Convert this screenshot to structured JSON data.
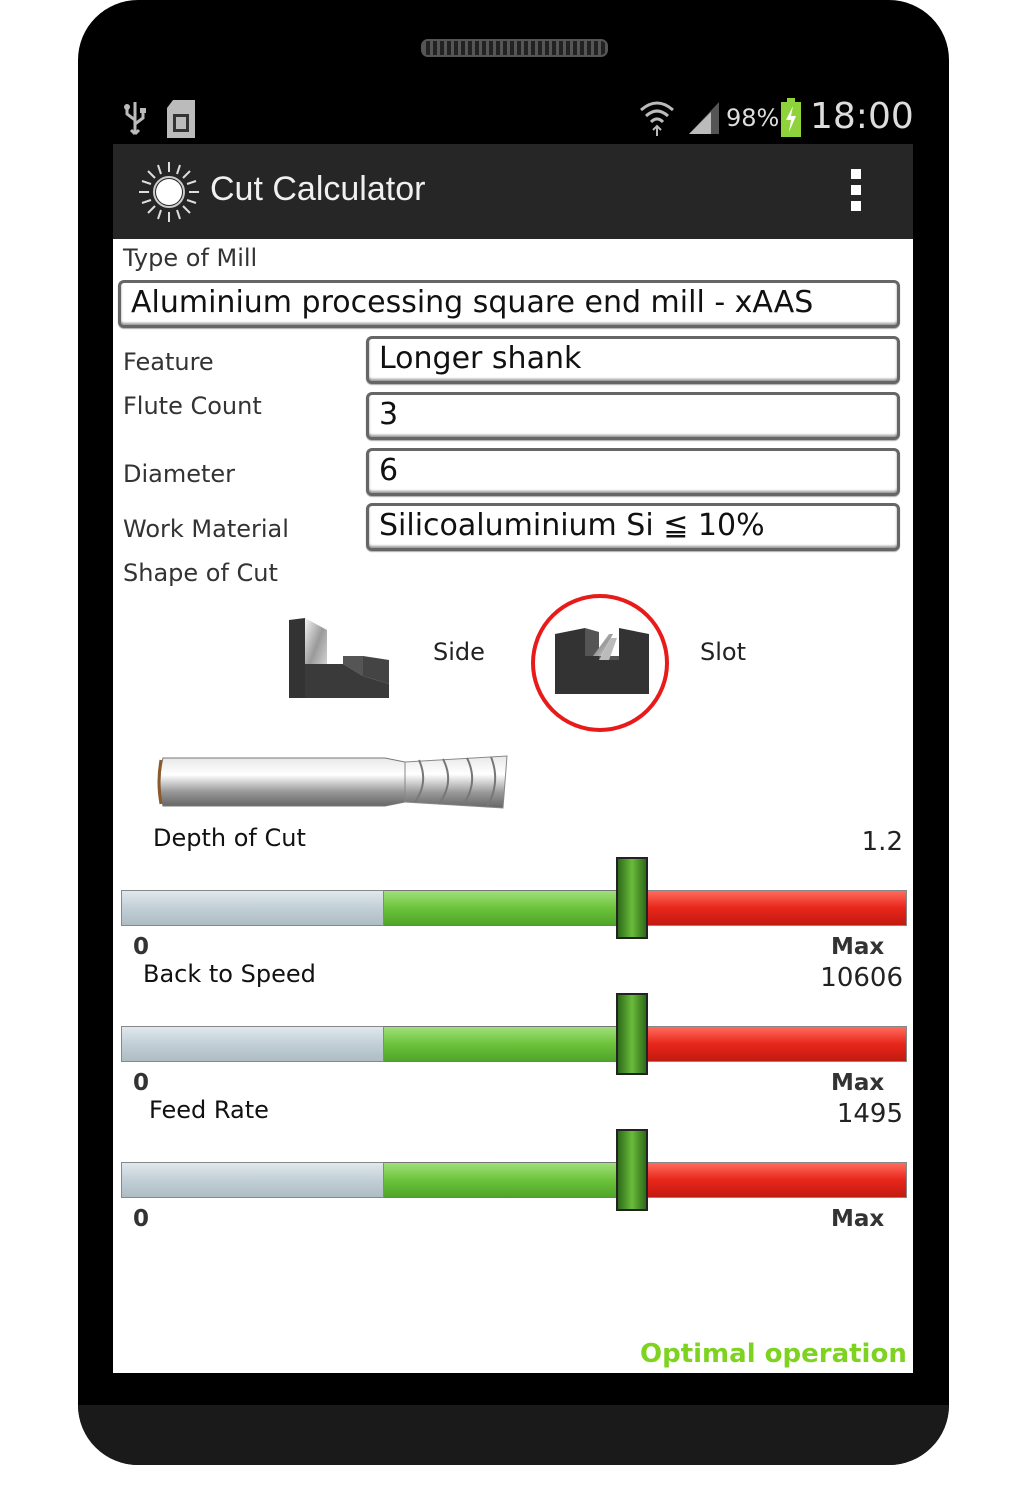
{
  "status_bar": {
    "battery": "98%",
    "time": "18:00",
    "icons": [
      "usb-icon",
      "sd-card-icon",
      "wifi-icon",
      "signal-icon",
      "battery-charging-icon"
    ]
  },
  "action_bar": {
    "title": "Cut Calculator",
    "logo_icon": "saw-blade-logo-icon",
    "menu_icon": "overflow-menu-icon"
  },
  "form": {
    "type_of_mill_label": "Type of Mill",
    "type_of_mill_value": "Aluminium processing square end mill - xAAS",
    "feature_label": "Feature",
    "feature_value": "Longer shank",
    "flute_count_label": "Flute Count",
    "flute_count_value": "3",
    "diameter_label": "Diameter",
    "diameter_value": "6",
    "work_material_label": "Work Material",
    "work_material_value": "Silicoaluminium Si ≦ 10%",
    "shape_of_cut_label": "Shape of Cut"
  },
  "shape_options": {
    "side_label": "Side",
    "slot_label": "Slot",
    "selected": "Slot",
    "selection_color": "#e81b1b"
  },
  "sliders": [
    {
      "label": "Depth of Cut",
      "value": "1.2",
      "min_label": "0",
      "max_label": "Max",
      "level": 0.65
    },
    {
      "label": "Back to Speed",
      "value": "10606",
      "min_label": "0",
      "max_label": "Max",
      "level": 0.65
    },
    {
      "label": "Feed Rate",
      "value": "1495",
      "min_label": "0",
      "max_label": "Max",
      "level": 0.65
    }
  ],
  "status_message": "Optimal operation",
  "colors": {
    "status_ok": "#7ed321",
    "zone_low": "#c2cfd6",
    "zone_optimal": "#6cc33b",
    "zone_high": "#e8261b"
  }
}
